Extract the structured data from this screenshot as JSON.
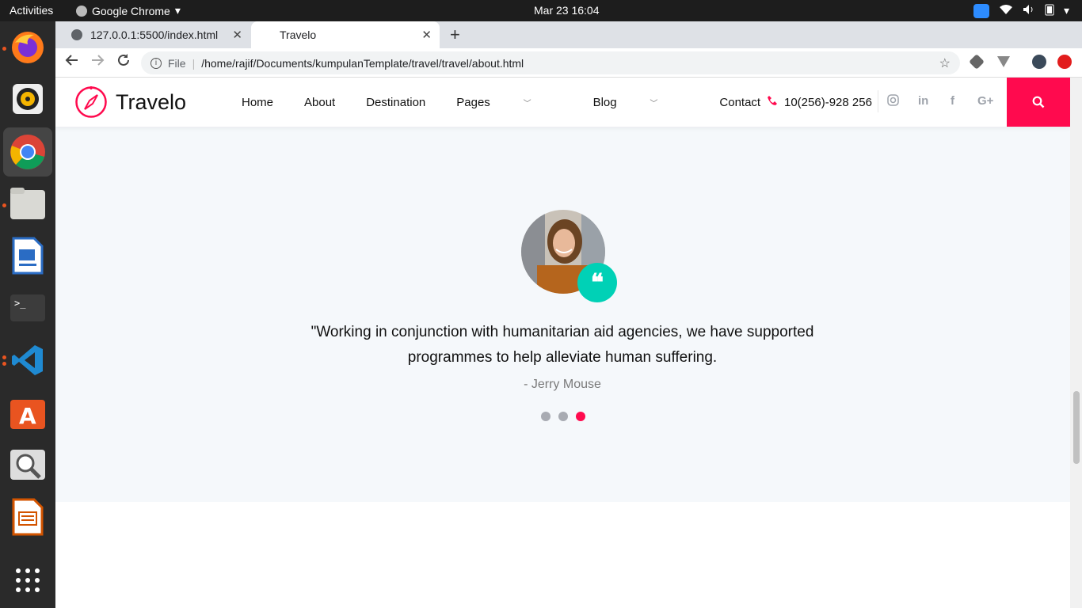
{
  "system": {
    "activities": "Activities",
    "app_name": "Google Chrome",
    "clock": "Mar 23  16:04"
  },
  "browser": {
    "tabs": [
      {
        "title": "127.0.0.1:5500/index.html"
      },
      {
        "title": "Travelo"
      }
    ],
    "address": {
      "scheme_label": "File",
      "url": "/home/rajif/Documents/kumpulanTemplate/travel/travel/about.html"
    }
  },
  "site": {
    "logo_text": "Travelo",
    "menu": [
      "Home",
      "About",
      "Destination",
      "Pages",
      "Blog",
      "Contact"
    ],
    "phone": "10(256)-928 256",
    "social_icons": [
      "instagram-icon",
      "linkedin-icon",
      "facebook-icon",
      "google-plus-icon"
    ],
    "accent_color": "#ff0a4e",
    "badge_color": "#00d1b6"
  },
  "testimonial": {
    "quote": "\"Working in conjunction with humanitarian aid agencies, we have supported programmes to help alleviate human suffering.",
    "author": "- Jerry Mouse",
    "slide_count": 3,
    "active_slide": 3
  }
}
